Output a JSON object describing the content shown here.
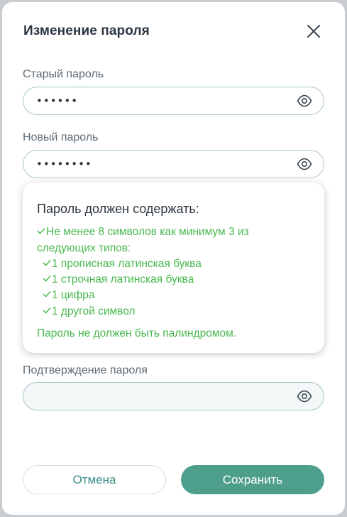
{
  "dialog": {
    "title": "Изменение пароля"
  },
  "old_password": {
    "label": "Старый пароль",
    "value": "••••••"
  },
  "new_password": {
    "label": "Новый пароль",
    "value": "••••••••"
  },
  "requirements": {
    "title": "Пароль должен содержать:",
    "line1": "Не менее 8 символов",
    "line1_suffix": " как минимум 3 из",
    "line2": "следующих типов:",
    "items": [
      "1 прописная латинская буква",
      "1 строчная латинская буква",
      "1 цифра",
      "1 другой символ"
    ],
    "palindrome": "Пароль не должен быть палиндромом."
  },
  "confirm_password": {
    "label": "Подтверждение пароля",
    "value": ""
  },
  "buttons": {
    "cancel": "Отмена",
    "save": "Сохранить"
  },
  "colors": {
    "accent": "#4e9e8c",
    "success": "#48b84e",
    "text": "#2b3540"
  },
  "icons": {
    "close": "close-icon",
    "eye": "eye-icon",
    "check": "check-icon"
  }
}
